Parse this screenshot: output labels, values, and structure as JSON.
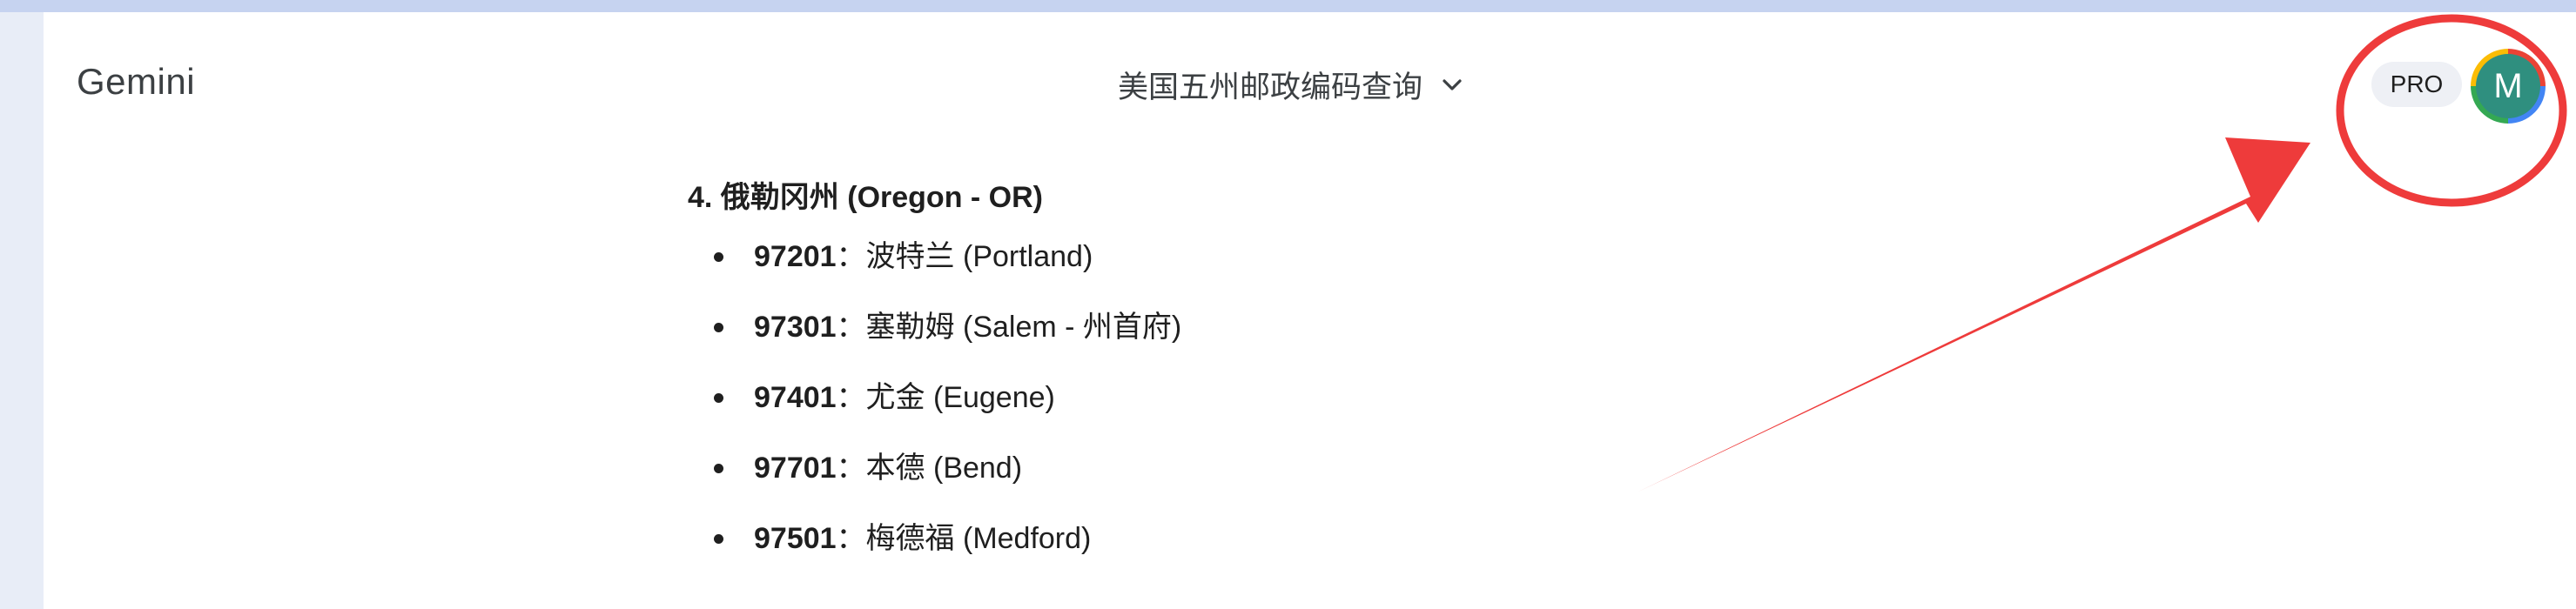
{
  "header": {
    "app_title": "Gemini",
    "conversation_title": "美国五州邮政编码查询",
    "pro_badge": "PRO",
    "avatar_letter": "M"
  },
  "content": {
    "heading": "4. 俄勒冈州 (Oregon - OR)",
    "items": [
      {
        "zip": "97201",
        "separator": "：",
        "city": "波特兰 (Portland)"
      },
      {
        "zip": "97301",
        "separator": "：",
        "city": "塞勒姆 (Salem - 州首府)"
      },
      {
        "zip": "97401",
        "separator": "：",
        "city": "尤金 (Eugene)"
      },
      {
        "zip": "97701",
        "separator": "：",
        "city": "本德 (Bend)"
      },
      {
        "zip": "97501",
        "separator": "：",
        "city": "梅德福 (Medford)"
      }
    ]
  },
  "colors": {
    "annotation": "#ee3b3b",
    "avatar_bg": "#2f8f7f",
    "frame_bg": "#e8edf7"
  }
}
